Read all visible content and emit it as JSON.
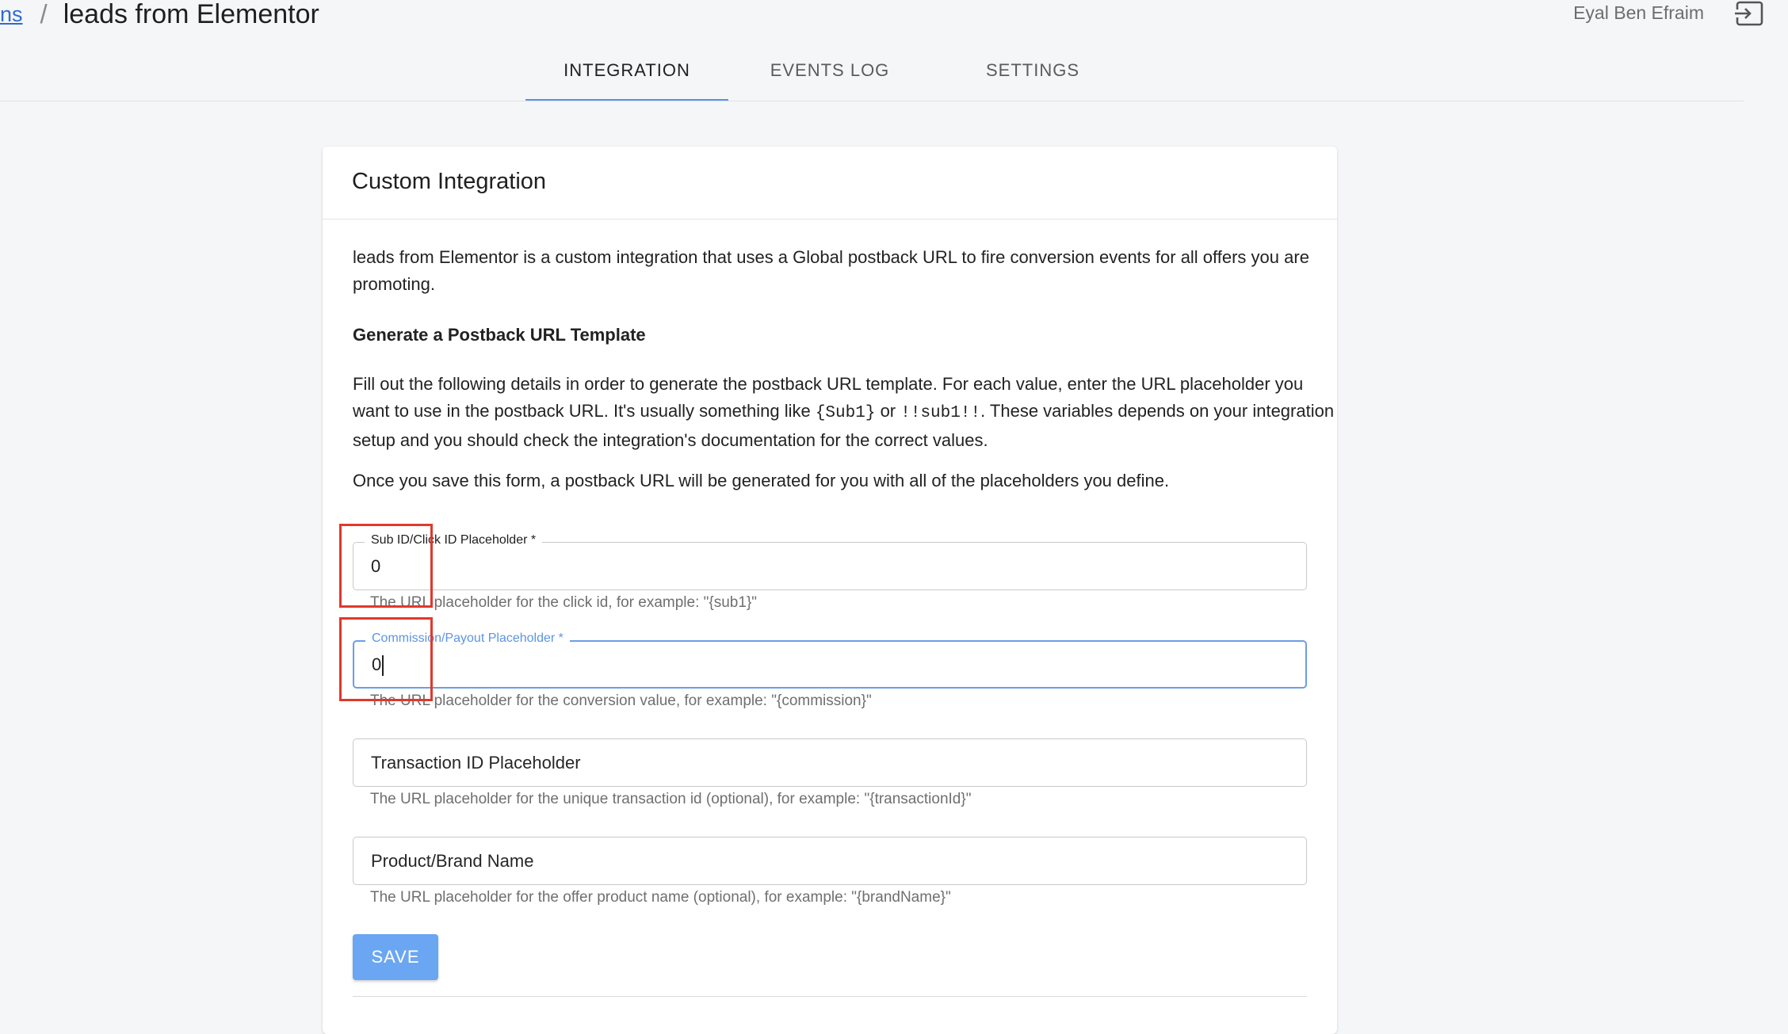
{
  "header": {
    "breadcrumb_link": "ns",
    "breadcrumb_separator": "/",
    "page_title": "leads from Elementor",
    "user_name": "Eyal Ben Efraim",
    "logout_icon": "logout-icon"
  },
  "tabs": [
    {
      "label": "INTEGRATION",
      "active": true
    },
    {
      "label": "EVENTS LOG",
      "active": false
    },
    {
      "label": "SETTINGS",
      "active": false
    }
  ],
  "card": {
    "title": "Custom Integration",
    "intro": "leads from Elementor is a custom integration that uses a Global postback URL to fire conversion events for all offers you are promoting.",
    "section_heading": "Generate a Postback URL Template",
    "instructions_part1": "Fill out the following details in order to generate the postback URL template. For each value, enter the URL placeholder you want to use in the postback URL. It's usually something like ",
    "code_example_1": "{Sub1}",
    "instructions_or": " or ",
    "code_example_2": "!!sub1!!",
    "instructions_part2": ". These variables depends on your integration setup and you should check the integration's documentation for the correct values.",
    "save_note": "Once you save this form, a postback URL will be generated for you with all of the placeholders you define."
  },
  "fields": {
    "sub_id": {
      "label": "Sub ID/Click ID Placeholder *",
      "value": "0",
      "helper": "The URL placeholder for the click id, for example: \"{sub1}\""
    },
    "commission": {
      "label": "Commission/Payout Placeholder *",
      "value": "0",
      "helper": "The URL placeholder for the conversion value, for example: \"{commission}\""
    },
    "transaction_id": {
      "placeholder": "Transaction ID Placeholder",
      "value": "",
      "helper": "The URL placeholder for the unique transaction id (optional), for example: \"{transactionId}\""
    },
    "brand_name": {
      "placeholder": "Product/Brand Name",
      "value": "",
      "helper": "The URL placeholder for the offer product name (optional), for example: \"{brandName}\""
    }
  },
  "actions": {
    "save_label": "SAVE"
  },
  "colors": {
    "accent": "#5b93e5",
    "save_button": "#6aa6f2",
    "highlight": "#e0392b"
  }
}
